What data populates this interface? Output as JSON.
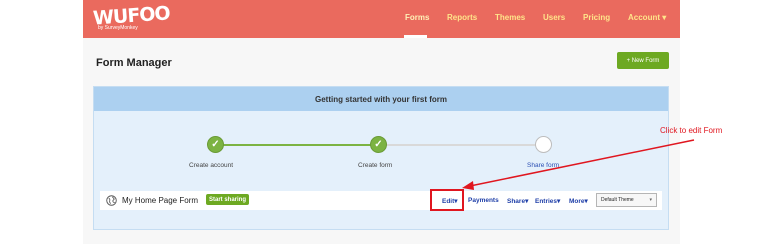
{
  "brand": {
    "logo_text": "WUFOO",
    "logo_sub": "by SurveyMonkey"
  },
  "nav": {
    "items": [
      "Forms",
      "Reports",
      "Themes",
      "Users",
      "Pricing",
      "Account ▾"
    ],
    "active": "Forms"
  },
  "page": {
    "title": "Form Manager",
    "new_form_button": "+ New Form"
  },
  "getting_started": {
    "title": "Getting started with your first form",
    "steps": [
      {
        "label": "Create account",
        "done": true
      },
      {
        "label": "Create form",
        "done": true
      },
      {
        "label": "Share form",
        "done": false
      }
    ],
    "check_glyph": "✓"
  },
  "form_row": {
    "name": "My Home Page Form",
    "badge": "Start sharing",
    "actions": [
      "Edit▾",
      "Payments",
      "Share▾",
      "Entries▾",
      "More▾"
    ],
    "theme_select": "Default Theme"
  },
  "annotation": {
    "text": "Click to edit Form"
  },
  "colors": {
    "header": "#ea6a5e",
    "nav_text": "#ffe58a",
    "accent_green": "#6da922",
    "panel_bg": "#e4f0fb",
    "panel_header": "#acd0f0",
    "link_blue": "#1f3fa8",
    "annotation_red": "#e0161f"
  },
  "icons": {
    "globe": "globe-icon",
    "check": "checkmark-icon",
    "dropdown": "chevron-down-icon"
  }
}
